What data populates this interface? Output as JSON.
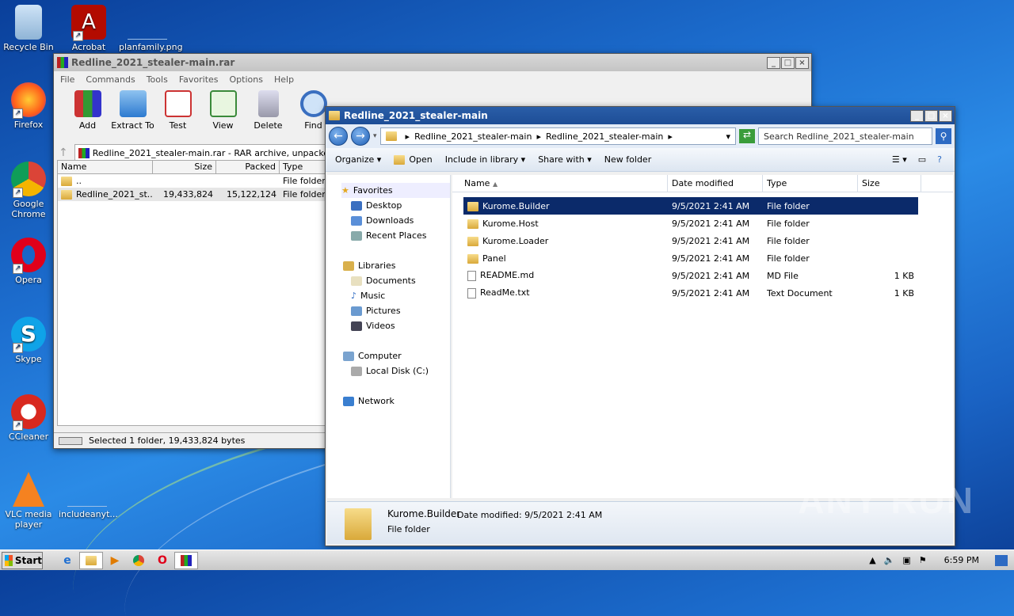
{
  "desktop": {
    "icons": [
      {
        "label": "Recycle Bin"
      },
      {
        "label": "Acrobat"
      },
      {
        "label": "planfamily.png"
      },
      {
        "label": "Firefox"
      },
      {
        "label": "Google Chrome"
      },
      {
        "label": "Opera"
      },
      {
        "label": "Skype"
      },
      {
        "label": "CCleaner"
      },
      {
        "label": "VLC media player"
      },
      {
        "label": "includeanyt..."
      }
    ],
    "watermark": "ANY RUN"
  },
  "rar_window": {
    "title": "Redline_2021_stealer-main.rar",
    "menu": [
      "File",
      "Commands",
      "Tools",
      "Favorites",
      "Options",
      "Help"
    ],
    "toolbar": [
      "Add",
      "Extract To",
      "Test",
      "View",
      "Delete",
      "Find"
    ],
    "address": "Redline_2021_stealer-main.rar - RAR archive, unpacke",
    "columns": [
      "Name",
      "Size",
      "Packed",
      "Type"
    ],
    "rows": [
      {
        "name": "..",
        "size": "",
        "packed": "",
        "type": "File folder"
      },
      {
        "name": "Redline_2021_st...",
        "size": "19,433,824",
        "packed": "15,122,124",
        "type": "File folder"
      }
    ],
    "status": "Selected 1 folder, 19,433,824 bytes"
  },
  "explorer": {
    "title": "Redline_2021_stealer-main",
    "breadcrumb": [
      "Redline_2021_stealer-main",
      "Redline_2021_stealer-main"
    ],
    "search_placeholder": "Search Redline_2021_stealer-main",
    "commands": [
      "Organize",
      "Open",
      "Include in library",
      "Share with",
      "New folder"
    ],
    "nav": {
      "favorites": "Favorites",
      "fav_items": [
        "Desktop",
        "Downloads",
        "Recent Places"
      ],
      "libraries": "Libraries",
      "lib_items": [
        "Documents",
        "Music",
        "Pictures",
        "Videos"
      ],
      "computer": "Computer",
      "computer_items": [
        "Local Disk (C:)"
      ],
      "network": "Network"
    },
    "columns": [
      "Name",
      "Date modified",
      "Type",
      "Size"
    ],
    "files": [
      {
        "name": "Kurome.Builder",
        "date": "9/5/2021 2:41 AM",
        "type": "File folder",
        "size": ""
      },
      {
        "name": "Kurome.Host",
        "date": "9/5/2021 2:41 AM",
        "type": "File folder",
        "size": ""
      },
      {
        "name": "Kurome.Loader",
        "date": "9/5/2021 2:41 AM",
        "type": "File folder",
        "size": ""
      },
      {
        "name": "Panel",
        "date": "9/5/2021 2:41 AM",
        "type": "File folder",
        "size": ""
      },
      {
        "name": "README.md",
        "date": "9/5/2021 2:41 AM",
        "type": "MD File",
        "size": "1 KB"
      },
      {
        "name": "ReadMe.txt",
        "date": "9/5/2021 2:41 AM",
        "type": "Text Document",
        "size": "1 KB"
      }
    ],
    "details": {
      "name": "Kurome.Builder",
      "date_label": "Date modified: 9/5/2021 2:41 AM",
      "type": "File folder"
    }
  },
  "taskbar": {
    "start": "Start",
    "time": "6:59 PM"
  }
}
